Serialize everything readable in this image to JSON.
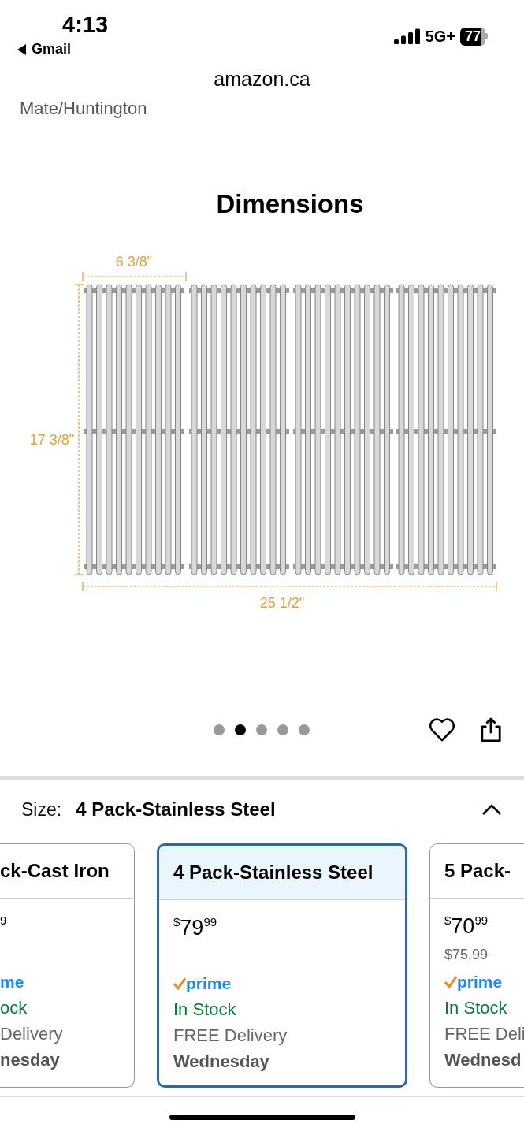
{
  "status_bar": {
    "time": "4:13",
    "back_app": "Gmail",
    "network": "5G+",
    "battery": "77"
  },
  "address_bar": {
    "domain": "amazon.ca"
  },
  "product_title_tail": "Mate/Huntington",
  "product_image": {
    "title": "Dimensions",
    "width_label": "6 3/8\"",
    "height_label": "17 3/8\"",
    "total_width_label": "25 1/2\""
  },
  "carousel_dots": [
    {
      "selected": false
    },
    {
      "selected": true
    },
    {
      "selected": false
    },
    {
      "selected": false
    },
    {
      "selected": false
    }
  ],
  "size": {
    "label": "Size:",
    "value": "4 Pack-Stainless Steel",
    "expanded": true
  },
  "size_options": [
    {
      "kind": "cut-left",
      "selected": false,
      "title": "ck-Cast Iron",
      "price": {
        "fraction": "9"
      },
      "prime": "me",
      "stock": "ock",
      "delivery": "Delivery",
      "day": "nesday"
    },
    {
      "kind": "full",
      "selected": true,
      "title": "4 Pack-Stainless Steel",
      "price": {
        "currency": "$",
        "whole": "79",
        "fraction": "99"
      },
      "prime": "prime",
      "stock": "In Stock",
      "delivery": "FREE Delivery",
      "day": "Wednesday"
    },
    {
      "kind": "cut-right",
      "selected": false,
      "title": "5 Pack-",
      "price": {
        "currency": "$",
        "whole": "70",
        "fraction": "99"
      },
      "list_price": "$75.99",
      "prime": "prime",
      "stock": "In Stock",
      "delivery": "FREE Deli",
      "day": "Wednesd"
    }
  ]
}
